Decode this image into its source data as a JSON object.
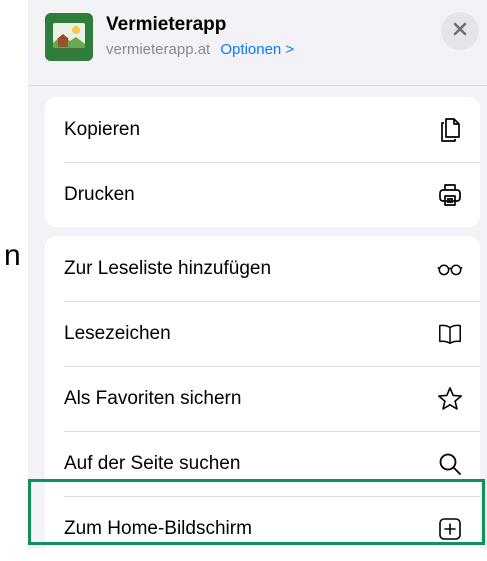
{
  "background": {
    "partial_text": "n"
  },
  "header": {
    "app_name": "Vermieterapp",
    "url": "vermieterapp.at",
    "options_label": "Optionen >"
  },
  "group1": {
    "items": [
      {
        "label": "Kopieren",
        "icon": "copy-icon"
      },
      {
        "label": "Drucken",
        "icon": "printer-icon"
      }
    ]
  },
  "group2": {
    "items": [
      {
        "label": "Zur Leseliste hinzufügen",
        "icon": "glasses-icon"
      },
      {
        "label": "Lesezeichen",
        "icon": "book-icon"
      },
      {
        "label": "Als Favoriten sichern",
        "icon": "star-icon"
      },
      {
        "label": "Auf der Seite suchen",
        "icon": "search-icon"
      },
      {
        "label": "Zum Home-Bildschirm",
        "icon": "add-square-icon"
      }
    ]
  },
  "colors": {
    "accent": "#0a7aff",
    "highlight": "#11915a",
    "sheet_bg": "#f2f2f7",
    "app_icon_bg": "#2f7d3a"
  }
}
